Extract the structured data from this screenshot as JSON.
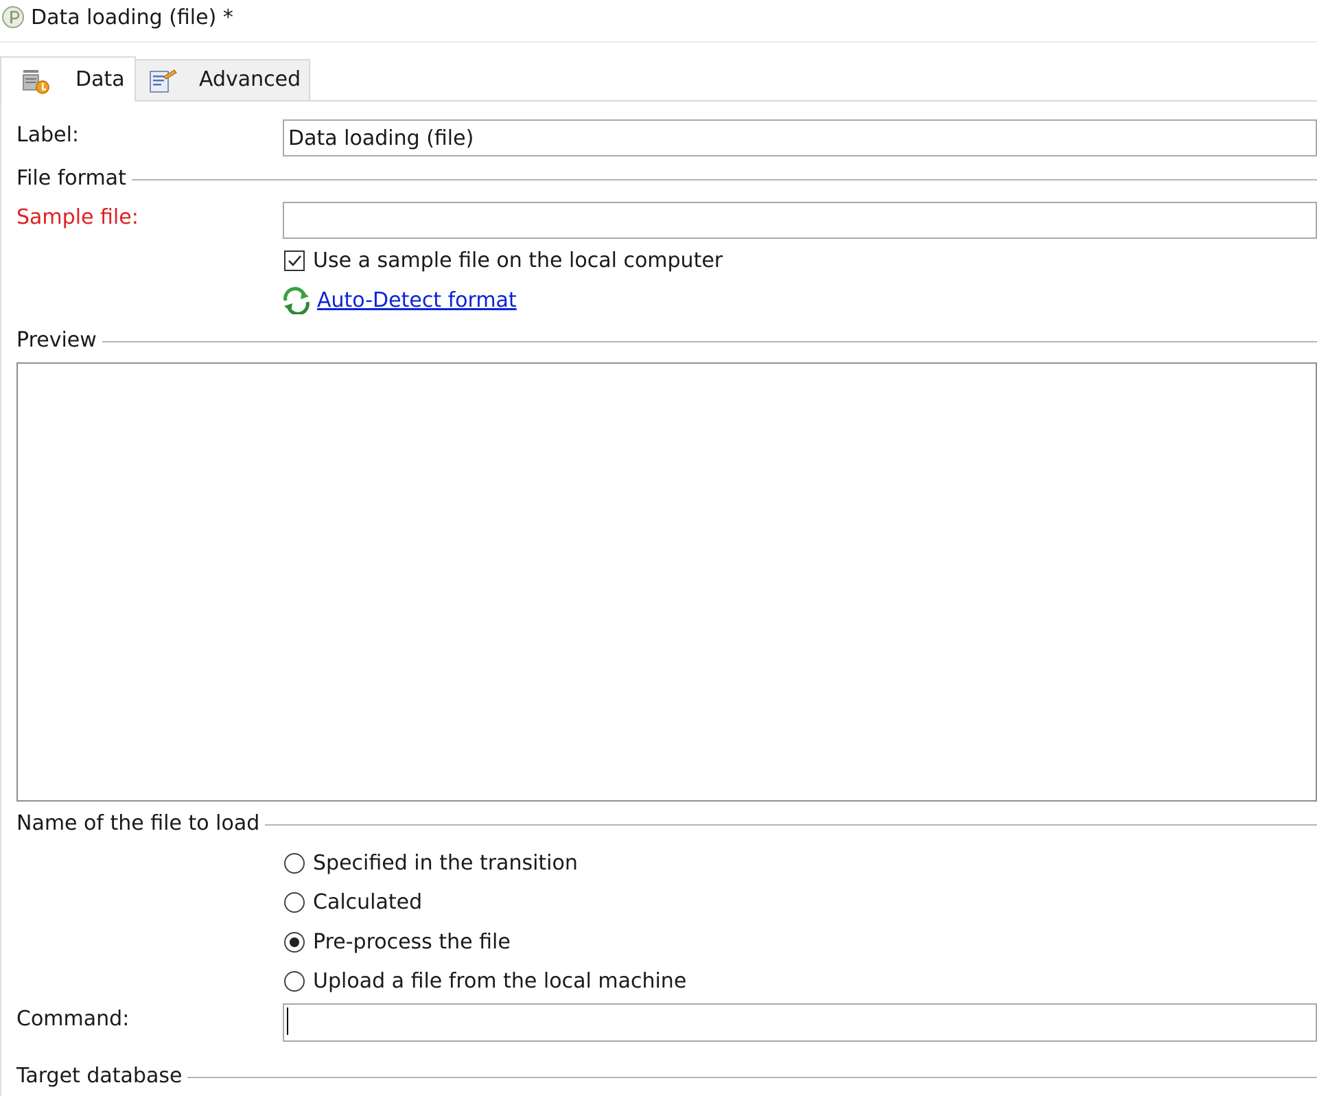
{
  "window": {
    "title": "Data loading (file) *"
  },
  "tabs": [
    {
      "label": "Data",
      "icon": "data-load-icon",
      "active": true
    },
    {
      "label": "Advanced",
      "icon": "advanced-settings-icon",
      "active": false
    }
  ],
  "form": {
    "label_field": {
      "label": "Label:",
      "value": "Data loading (file)"
    },
    "file_format": {
      "section_title": "File format",
      "sample_file": {
        "label": "Sample file:",
        "value": "",
        "required_color": "#e02020"
      },
      "use_local_checkbox": {
        "label": "Use a sample file on the local computer",
        "checked": true
      },
      "auto_detect_link": {
        "label": "Auto-Detect format",
        "icon": "refresh-icon"
      }
    },
    "preview": {
      "section_title": "Preview"
    },
    "file_to_load": {
      "section_title": "Name of the file to load",
      "options": [
        {
          "label": "Specified in the transition",
          "selected": false
        },
        {
          "label": "Calculated",
          "selected": false
        },
        {
          "label": "Pre-process the file",
          "selected": true
        },
        {
          "label": "Upload a file from the local machine",
          "selected": false
        }
      ]
    },
    "command": {
      "label": "Command:",
      "value": ""
    },
    "target_database": {
      "section_title": "Target database"
    }
  }
}
